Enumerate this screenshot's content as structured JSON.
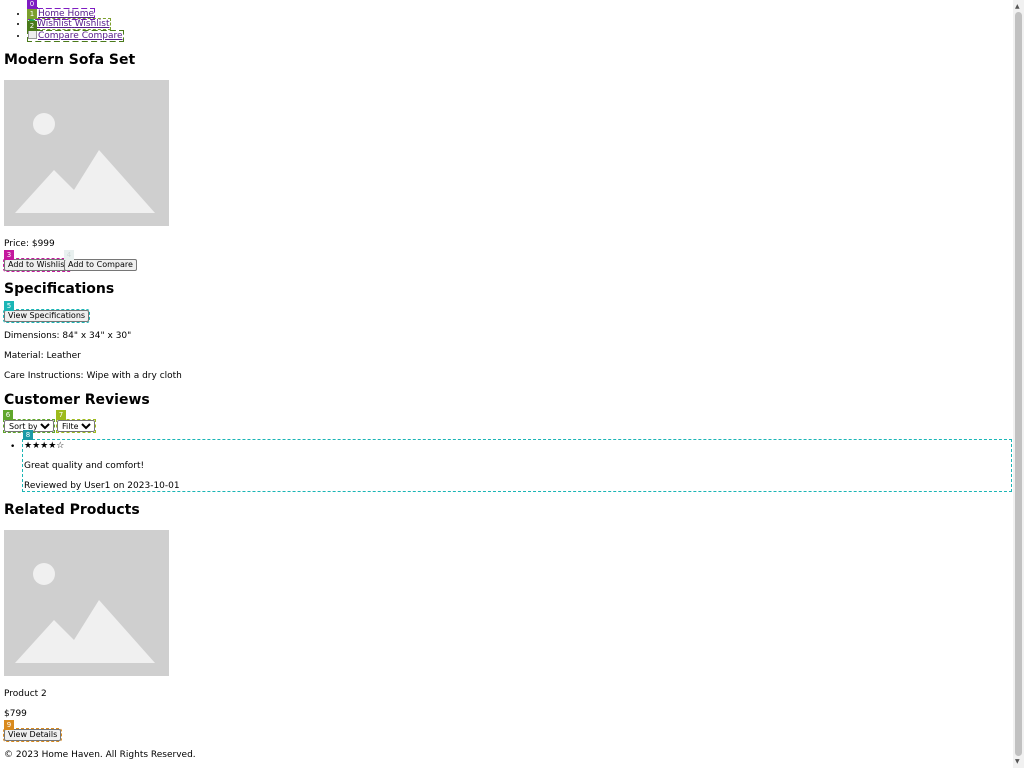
{
  "nav": {
    "home": {
      "alt": "Home",
      "label": "Home"
    },
    "wishlist": {
      "alt": "Wishlist",
      "label": "Wishlist"
    },
    "compare": {
      "alt": "Compare",
      "label": "Compare"
    }
  },
  "product": {
    "title": "Modern Sofa Set",
    "price": "Price: $999",
    "add_to_wishlist": "Add to Wishlist",
    "add_to_compare": "Add to Compare"
  },
  "specs": {
    "heading": "Specifications",
    "view_button": "View Specifications",
    "dimensions": "Dimensions: 84\" x 34\" x 30\"",
    "material": "Material: Leather",
    "care": "Care Instructions: Wipe with a dry cloth"
  },
  "reviews": {
    "heading": "Customer Reviews",
    "sort_label": "Sort by",
    "filter_label": "Filter by",
    "items": [
      {
        "stars": "★★★★☆",
        "text": "Great quality and comfort!",
        "byline": "Reviewed by User1 on 2023-10-01"
      }
    ]
  },
  "related": {
    "heading": "Related Products",
    "items": [
      {
        "name": "Product 2",
        "price": "$799",
        "button": "View Details"
      }
    ]
  },
  "footer": {
    "text": "© 2023 Home Haven. All Rights Reserved."
  },
  "som_labels": [
    "0",
    "1",
    "2",
    "3",
    "4",
    "5",
    "6",
    "7",
    "8",
    "9"
  ],
  "colors": {
    "som0": "#7e1cc2",
    "som1": "#7b9f2c",
    "som2": "#4a7a1a",
    "som3": "#c4199d",
    "som4": "#e8f0ef",
    "som5": "#1bb5b5",
    "som6": "#5fa62a",
    "som7": "#9dbb1c",
    "som8": "#1a9aa6",
    "som9": "#d98a1e"
  }
}
